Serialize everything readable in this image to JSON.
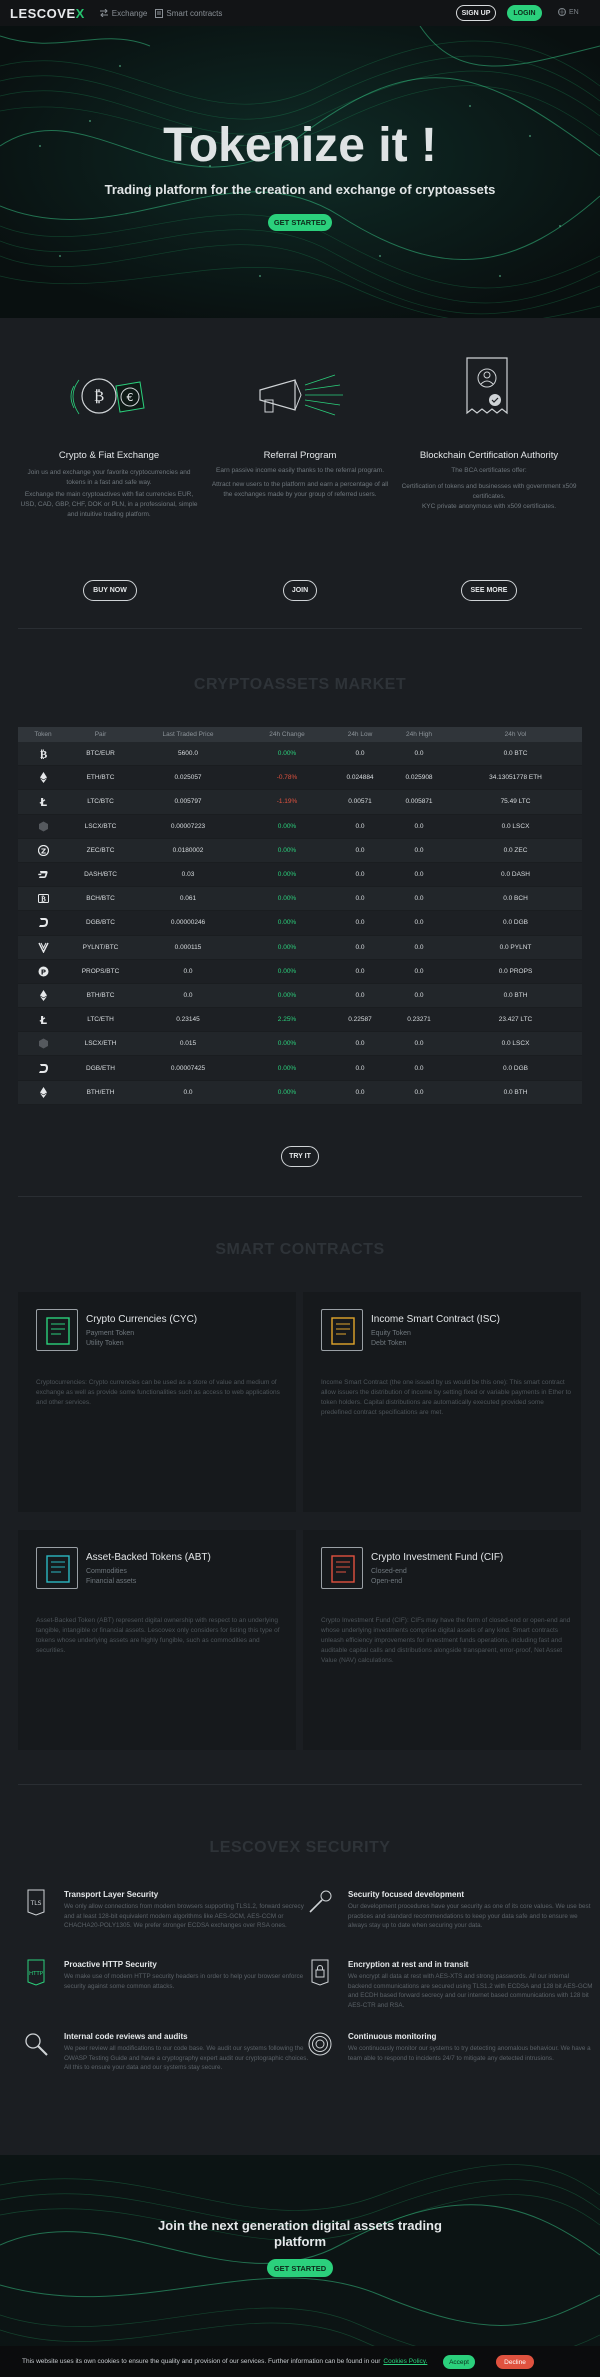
{
  "header": {
    "logo_main": "LESCOVE",
    "logo_accent": "X",
    "nav": [
      "Exchange",
      "Smart contracts"
    ],
    "signup": "SIGN UP",
    "login": "LOGIN",
    "lang": "EN"
  },
  "hero": {
    "title": "Tokenize it !",
    "subtitle": "Trading platform for the creation and exchange of cryptoassets",
    "cta": "GET STARTED"
  },
  "features": [
    {
      "title": "Crypto & Fiat Exchange",
      "text1": "Join us and exchange your favorite cryptocurrencies and tokens in a fast and safe way.",
      "text2": "Exchange the main cryptoactives with fiat currencies EUR, USD, CAD, GBP, CHF, DOK or PLN, in a professional, simple and intuitive trading platform.",
      "button": "BUY NOW"
    },
    {
      "title": "Referral Program",
      "text1": "Earn passive income easily thanks to the referral program.",
      "text2": "Attract new users to the platform and earn a percentage of all the exchanges made by your group of referred users.",
      "button": "JOIN"
    },
    {
      "title": "Blockchain Certification Authority",
      "text1": "The BCA certificates offer:",
      "text2": "Certification of tokens and businesses with government x509 certificates.",
      "text3": "KYC private anonymous with x509 certificates.",
      "button": "SEE MORE"
    }
  ],
  "market": {
    "title": "CRYPTOASSETS MARKET",
    "columns": [
      "Token",
      "Pair",
      "Last Traded Price",
      "24h Change",
      "24h Low",
      "24h High",
      "24h Vol"
    ],
    "rows": [
      {
        "icon": "bitcoin-icon",
        "pair": "BTC/EUR",
        "price": "5600.0",
        "change": "0.00%",
        "dir": "pos",
        "low": "0.0",
        "high": "0.0",
        "vol": "0.0 BTC"
      },
      {
        "icon": "ethereum-icon",
        "pair": "ETH/BTC",
        "price": "0.025057",
        "change": "-0.78%",
        "dir": "neg",
        "low": "0.024884",
        "high": "0.025908",
        "vol": "34.13051778 ETH"
      },
      {
        "icon": "litecoin-icon",
        "pair": "LTC/BTC",
        "price": "0.005797",
        "change": "-1.19%",
        "dir": "neg",
        "low": "0.00571",
        "high": "0.005871",
        "vol": "75.49 LTC"
      },
      {
        "icon": "lescovex-icon",
        "pair": "LSCX/BTC",
        "price": "0.00007223",
        "change": "0.00%",
        "dir": "pos",
        "low": "0.0",
        "high": "0.0",
        "vol": "0.0 LSCX"
      },
      {
        "icon": "zcash-icon",
        "pair": "ZEC/BTC",
        "price": "0.0180002",
        "change": "0.00%",
        "dir": "pos",
        "low": "0.0",
        "high": "0.0",
        "vol": "0.0 ZEC"
      },
      {
        "icon": "dash-icon",
        "pair": "DASH/BTC",
        "price": "0.03",
        "change": "0.00%",
        "dir": "pos",
        "low": "0.0",
        "high": "0.0",
        "vol": "0.0 DASH"
      },
      {
        "icon": "bitcoin-cash-icon",
        "pair": "BCH/BTC",
        "price": "0.061",
        "change": "0.00%",
        "dir": "pos",
        "low": "0.0",
        "high": "0.0",
        "vol": "0.0 BCH"
      },
      {
        "icon": "digibyte-icon",
        "pair": "DGB/BTC",
        "price": "0.00000246",
        "change": "0.00%",
        "dir": "pos",
        "low": "0.0",
        "high": "0.0",
        "vol": "0.0 DGB"
      },
      {
        "icon": "pylon-icon",
        "pair": "PYLNT/BTC",
        "price": "0.000115",
        "change": "0.00%",
        "dir": "pos",
        "low": "0.0",
        "high": "0.0",
        "vol": "0.0 PYLNT"
      },
      {
        "icon": "props-icon",
        "pair": "PROPS/BTC",
        "price": "0.0",
        "change": "0.00%",
        "dir": "pos",
        "low": "0.0",
        "high": "0.0",
        "vol": "0.0 PROPS"
      },
      {
        "icon": "ethereum-icon",
        "pair": "BTH/BTC",
        "price": "0.0",
        "change": "0.00%",
        "dir": "pos",
        "low": "0.0",
        "high": "0.0",
        "vol": "0.0 BTH"
      },
      {
        "icon": "litecoin-icon",
        "pair": "LTC/ETH",
        "price": "0.23145",
        "change": "2.25%",
        "dir": "pos",
        "low": "0.22587",
        "high": "0.23271",
        "vol": "23.427 LTC"
      },
      {
        "icon": "lescovex-icon",
        "pair": "LSCX/ETH",
        "price": "0.015",
        "change": "0.00%",
        "dir": "pos",
        "low": "0.0",
        "high": "0.0",
        "vol": "0.0 LSCX"
      },
      {
        "icon": "digibyte-icon",
        "pair": "DGB/ETH",
        "price": "0.00007425",
        "change": "0.00%",
        "dir": "pos",
        "low": "0.0",
        "high": "0.0",
        "vol": "0.0 DGB"
      },
      {
        "icon": "ethereum-icon",
        "pair": "BTH/ETH",
        "price": "0.0",
        "change": "0.00%",
        "dir": "pos",
        "low": "0.0",
        "high": "0.0",
        "vol": "0.0 BTH"
      }
    ],
    "button": "TRY IT"
  },
  "contracts": {
    "title": "SMART CONTRACTS",
    "cards": [
      {
        "title": "Crypto Currencies (CYC)",
        "sub1": "Payment Token",
        "sub2": "Utility Token",
        "text": "Cryptocurrencies: Crypto currencies can be used as a store of value and medium of exchange as well as provide some functionalities such as access to web applications and other services.",
        "color": "#2bd07c"
      },
      {
        "title": "Income Smart Contract (ISC)",
        "sub1": "Equity Token",
        "sub2": "Debt Token",
        "text": "Income Smart Contract (the one issued by us would be this one): This smart contract allow issuers the distribution of income by setting fixed or variable payments in Ether to token holders. Capital distributions are automatically executed provided some predefined contract specifications are met.",
        "color": "#e0a52b"
      },
      {
        "title": "Asset-Backed Tokens (ABT)",
        "sub1": "Commodities",
        "sub2": "Financial assets",
        "text": "Asset-Backed Token (ABT) represent digital ownership with respect to an underlying tangible, intangible or financial assets. Lescovex only considers for listing this type of tokens whose underlying assets are highly fungible, such as commodities and securities.",
        "color": "#2bb8c2"
      },
      {
        "title": "Crypto Investment Fund (CIF)",
        "sub1": "Closed-end",
        "sub2": "Open-end",
        "text": "Crypto Investment Fund (CIF): CIFs may have the form of closed-end or open-end and whose underlying investments comprise digital assets of any kind. Smart contracts unleash efficiency improvements for investment funds operations, including fast and auditable capital calls and distributions alongside transparent, error-proof, Net Asset Value (NAV) calculations.",
        "color": "#e0523f"
      }
    ]
  },
  "security": {
    "title": "LESCOVEX SECURITY",
    "items": [
      {
        "icon": "tls-icon",
        "title": "Transport Layer Security",
        "text": "We only allow connections from modern browsers supporting TLS1.2, forward secrecy and at least 128-bit equivalent modern algorithms like AES-GCM, AES-CCM or CHACHA20-POLY1305. We prefer stronger ECDSA exchanges over RSA ones."
      },
      {
        "icon": "wrench-icon",
        "title": "Security focused development",
        "text": "Our development procedures have your security as one of its core values. We use best practices and standard recommendations to keep your data safe and to ensure we always stay up to date when securing your data."
      },
      {
        "icon": "http-icon",
        "title": "Proactive HTTP Security",
        "text": "We make use of modern HTTP security headers in order to help your browser enforce security against some common attacks."
      },
      {
        "icon": "lock-icon",
        "title": "Encryption at rest and in transit",
        "text": "We encrypt all data at rest with AES-XTS and strong passwords. All our internal backend communications are secured using TLS1.2 with ECDSA and 128 bit AES-GCM and ECDH based forward secrecy and our internet based communications with 128 bit AES-CTR and RSA."
      },
      {
        "icon": "magnifier-icon",
        "title": "Internal code reviews and audits",
        "text": "We peer review all modifications to our code base. We audit our systems following the OWASP Testing Guide and have a cryptography expert audit our cryptographic choices. All this to ensure your data and our systems stay secure."
      },
      {
        "icon": "spiral-icon",
        "title": "Continuous monitoring",
        "text": "We continuously monitor our systems to try detecting anomalous behaviour. We have a team able to respond to incidents 24/7 to mitigate any detected intrusions."
      }
    ]
  },
  "cta": {
    "title_line1": "Join the next generation digital assets trading",
    "title_line2": "platform",
    "button": "GET STARTED"
  },
  "cookie": {
    "text": "This website uses its own cookies to ensure the quality and provision of our services. Further information can be found in our",
    "link": "Cookies Policy.",
    "accept": "Accept",
    "decline": "Decline"
  }
}
